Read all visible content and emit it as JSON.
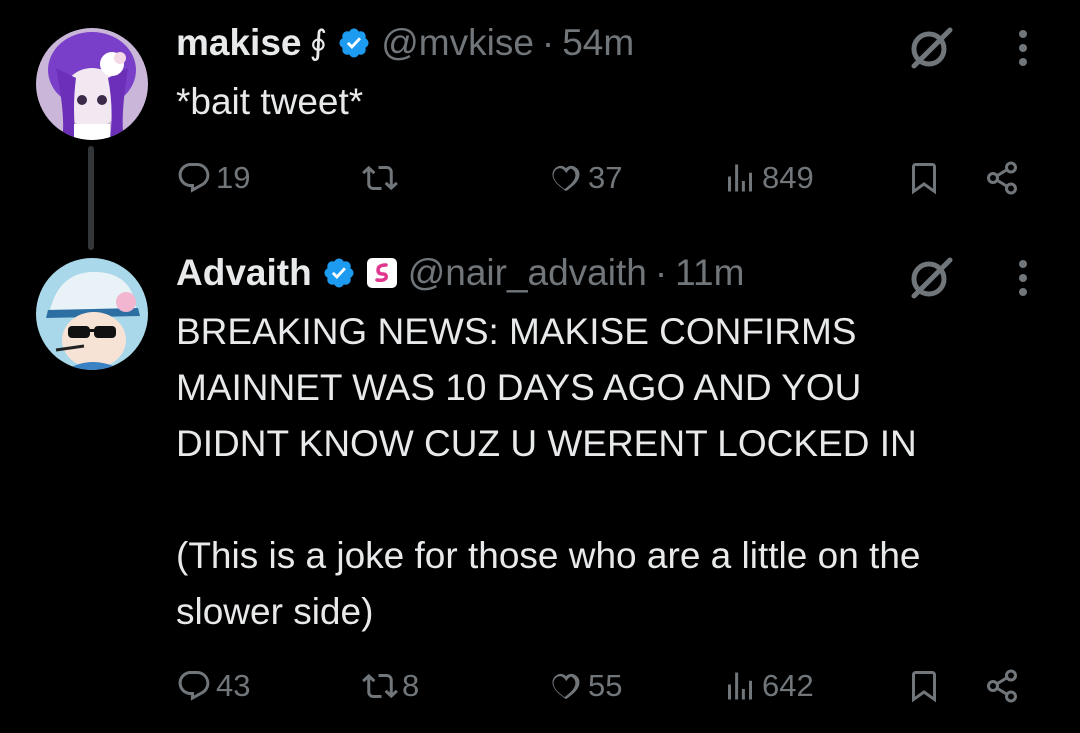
{
  "tweets": [
    {
      "name": "makise",
      "name_glyph": "∮",
      "handle": "@mvkise",
      "separator": "·",
      "time": "54m",
      "text": "*bait tweet*",
      "replies": "19",
      "retweets": "",
      "likes": "37",
      "views": "849"
    },
    {
      "name": "Advaith",
      "handle": "@nair_advaith",
      "separator": "·",
      "time": "11m",
      "text": "BREAKING NEWS: MAKISE CONFIRMS\nMAINNET WAS 10 DAYS AGO AND YOU\nDIDNT KNOW CUZ U WERENT LOCKED IN\n\n(This is a joke for those who are a little on the\nslower side)",
      "replies": "43",
      "retweets": "8",
      "likes": "55",
      "views": "642"
    }
  ],
  "colors": {
    "background": "#000000",
    "text": "#e7e9ea",
    "muted": "#71767b",
    "verified": "#1d9bf0",
    "badge_pink": "#e0368f"
  },
  "icons": [
    "verified-icon",
    "affiliate-badge-icon",
    "grok-icon",
    "more-icon",
    "reply-icon",
    "retweet-icon",
    "like-icon",
    "views-icon",
    "bookmark-icon",
    "share-icon"
  ]
}
